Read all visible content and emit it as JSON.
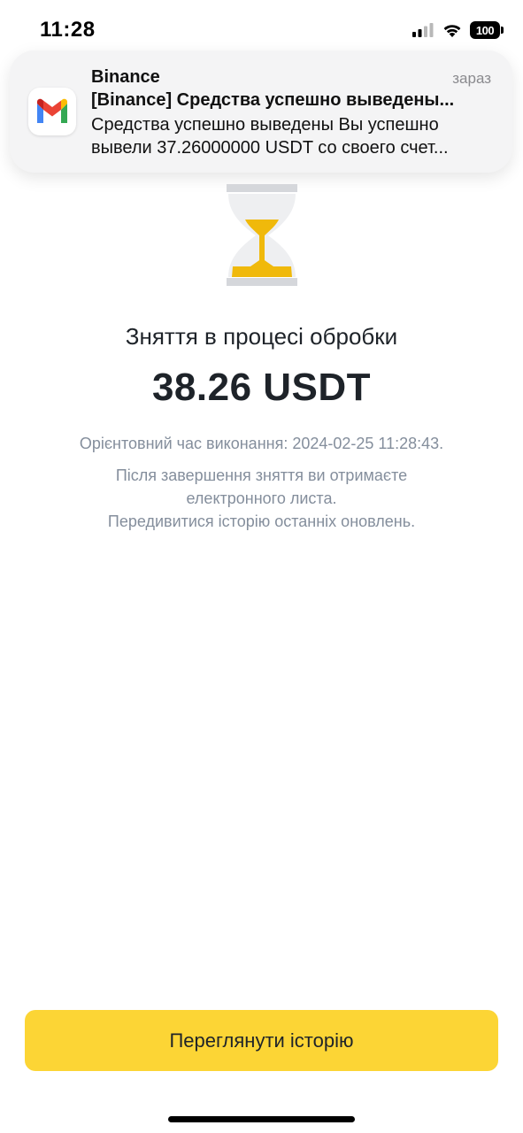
{
  "status_bar": {
    "time": "11:28",
    "battery": "100",
    "icons": [
      "signal-icon",
      "wifi-icon",
      "battery-icon"
    ]
  },
  "notification": {
    "app_icon": "gmail-icon",
    "sender": "Binance",
    "time": "зараз",
    "subject": "[Binance] Средства успешно выведены...",
    "body": "Средства успешно выведены Вы успешно вывели 37.26000000 USDT со своего счет..."
  },
  "main": {
    "icon": "hourglass-icon",
    "status_title": "Зняття в процесі обробки",
    "amount": "38.26 USDT",
    "estimated_time": "Орієнтовний час виконання: 2024-02-25 11:28:43.",
    "email_note": "Після завершення зняття ви отримаєте електронного листа.",
    "history_link": "Передивитися історію останніх оновлень."
  },
  "actions": {
    "view_history_label": "Переглянути історію"
  },
  "colors": {
    "accent": "#fcd535",
    "hourglass_sand": "#f0b90b",
    "hourglass_frame": "#d5d7db",
    "secondary_text": "#848e9c"
  }
}
